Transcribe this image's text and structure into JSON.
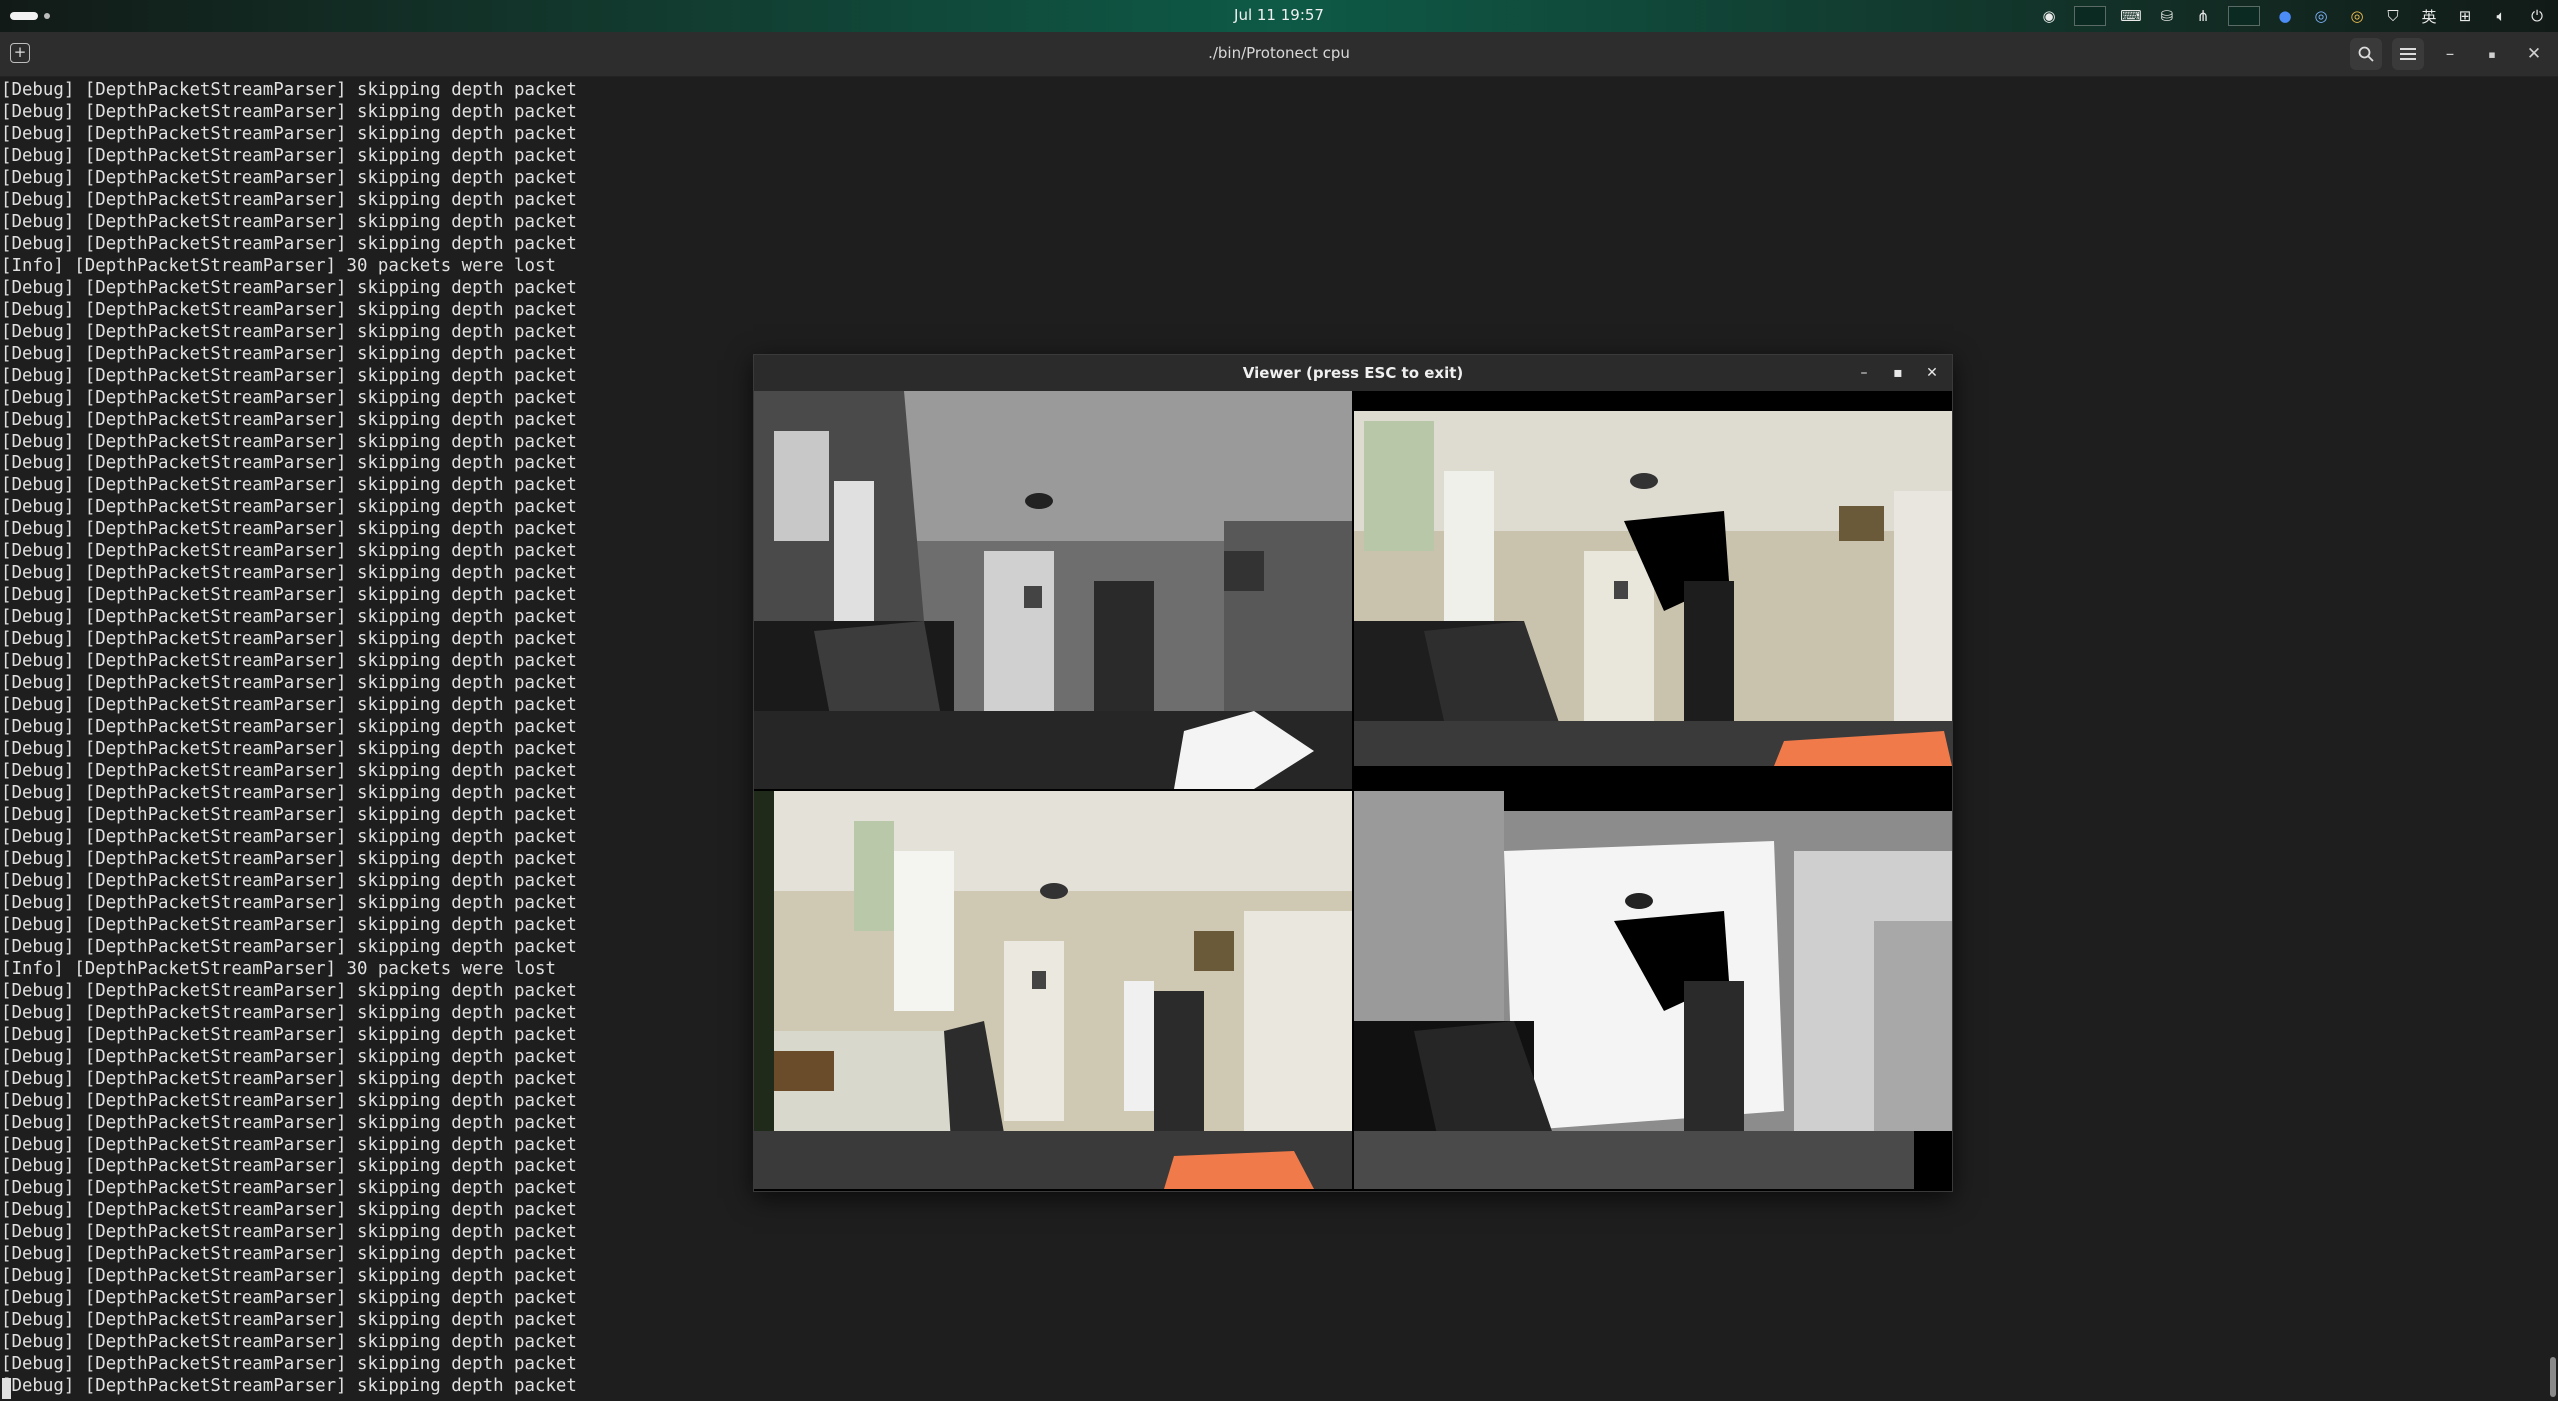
{
  "topbar": {
    "clock": "Jul 11  19:57",
    "tray_icons": [
      "screen-record-icon",
      "monitor-icon",
      "keyboard-icon",
      "drive-icon",
      "network-icon",
      "graph-icon",
      "zoom-icon",
      "chrome-canary-icon",
      "chrome-icon",
      "shield-icon",
      "ime-indicator",
      "network-wired-icon",
      "volume-icon",
      "power-icon"
    ],
    "ime_label": "英"
  },
  "terminal": {
    "title": "./bin/Protonect cpu",
    "debug_line": "[Debug] [DepthPacketStreamParser] skipping depth packet",
    "info_line": "[Info] [DepthPacketStreamParser] 30 packets were lost",
    "lines": [
      "[Debug] [DepthPacketStreamParser] skipping depth packet",
      "[Debug] [DepthPacketStreamParser] skipping depth packet",
      "[Debug] [DepthPacketStreamParser] skipping depth packet",
      "[Debug] [DepthPacketStreamParser] skipping depth packet",
      "[Debug] [DepthPacketStreamParser] skipping depth packet",
      "[Debug] [DepthPacketStreamParser] skipping depth packet",
      "[Debug] [DepthPacketStreamParser] skipping depth packet",
      "[Debug] [DepthPacketStreamParser] skipping depth packet",
      "[Info] [DepthPacketStreamParser] 30 packets were lost",
      "[Debug] [DepthPacketStreamParser] skipping depth packet",
      "[Debug] [DepthPacketStreamParser] skipping depth packet",
      "[Debug] [DepthPacketStreamParser] skipping depth packet",
      "[Debug] [DepthPacketStreamParser] skipping depth packet",
      "[Debug] [DepthPacketStreamParser] skipping depth packet",
      "[Debug] [DepthPacketStreamParser] skipping depth packet",
      "[Debug] [DepthPacketStreamParser] skipping depth packet",
      "[Debug] [DepthPacketStreamParser] skipping depth packet",
      "[Debug] [DepthPacketStreamParser] skipping depth packet",
      "[Debug] [DepthPacketStreamParser] skipping depth packet",
      "[Debug] [DepthPacketStreamParser] skipping depth packet",
      "[Debug] [DepthPacketStreamParser] skipping depth packet",
      "[Debug] [DepthPacketStreamParser] skipping depth packet",
      "[Debug] [DepthPacketStreamParser] skipping depth packet",
      "[Debug] [DepthPacketStreamParser] skipping depth packet",
      "[Debug] [DepthPacketStreamParser] skipping depth packet",
      "[Debug] [DepthPacketStreamParser] skipping depth packet",
      "[Debug] [DepthPacketStreamParser] skipping depth packet",
      "[Debug] [DepthPacketStreamParser] skipping depth packet",
      "[Debug] [DepthPacketStreamParser] skipping depth packet",
      "[Debug] [DepthPacketStreamParser] skipping depth packet",
      "[Debug] [DepthPacketStreamParser] skipping depth packet",
      "[Debug] [DepthPacketStreamParser] skipping depth packet",
      "[Debug] [DepthPacketStreamParser] skipping depth packet",
      "[Debug] [DepthPacketStreamParser] skipping depth packet",
      "[Debug] [DepthPacketStreamParser] skipping depth packet",
      "[Debug] [DepthPacketStreamParser] skipping depth packet",
      "[Debug] [DepthPacketStreamParser] skipping depth packet",
      "[Debug] [DepthPacketStreamParser] skipping depth packet",
      "[Debug] [DepthPacketStreamParser] skipping depth packet",
      "[Debug] [DepthPacketStreamParser] skipping depth packet",
      "[Info] [DepthPacketStreamParser] 30 packets were lost",
      "[Debug] [DepthPacketStreamParser] skipping depth packet",
      "[Debug] [DepthPacketStreamParser] skipping depth packet",
      "[Debug] [DepthPacketStreamParser] skipping depth packet",
      "[Debug] [DepthPacketStreamParser] skipping depth packet",
      "[Debug] [DepthPacketStreamParser] skipping depth packet",
      "[Debug] [DepthPacketStreamParser] skipping depth packet",
      "[Debug] [DepthPacketStreamParser] skipping depth packet",
      "[Debug] [DepthPacketStreamParser] skipping depth packet",
      "[Debug] [DepthPacketStreamParser] skipping depth packet",
      "[Debug] [DepthPacketStreamParser] skipping depth packet",
      "[Debug] [DepthPacketStreamParser] skipping depth packet",
      "[Debug] [DepthPacketStreamParser] skipping depth packet",
      "[Debug] [DepthPacketStreamParser] skipping depth packet",
      "[Debug] [DepthPacketStreamParser] skipping depth packet",
      "[Debug] [DepthPacketStreamParser] skipping depth packet",
      "[Debug] [DepthPacketStreamParser] skipping depth packet",
      "[Debug] [DepthPacketStreamParser] skipping depth packet",
      "[Debug] [DepthPacketStreamParser] skipping depth packet",
      "[Debug] [DepthPacketStreamParser] skipping depth packet"
    ]
  },
  "viewer": {
    "title": "Viewer (press ESC to exit)",
    "panes": [
      "infrared-view",
      "registered-color-view",
      "color-view",
      "depth-view"
    ]
  },
  "colors": {
    "terminal_bg": "#1e1e1e",
    "terminal_fg": "#e0e0e0",
    "header_bg": "#2d2d2d",
    "accent": "#0e5a47"
  }
}
